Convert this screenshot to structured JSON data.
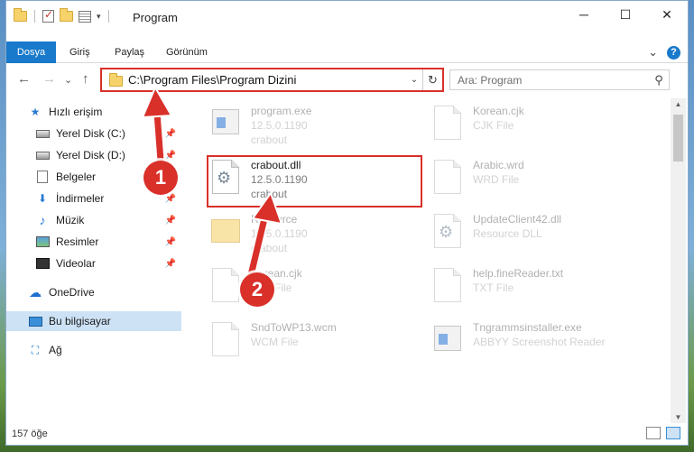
{
  "window": {
    "title": "Program",
    "controls": {
      "minimize": "─",
      "maximize": "☐",
      "close": "✕"
    }
  },
  "ribbon": {
    "tabs": [
      "Dosya",
      "Giriş",
      "Paylaş",
      "Görünüm"
    ],
    "expand_glyph": "⌄",
    "help_glyph": "?"
  },
  "nav": {
    "back": "←",
    "forward": "→",
    "recent": "⌄",
    "up": "↑",
    "address": "C:\\Program Files\\Program Dizini",
    "address_dropdown": "⌄",
    "refresh": "↻",
    "search_placeholder": "Ara: Program",
    "search_glyph": "⚲"
  },
  "sidebar": {
    "items": [
      {
        "label": "Hızlı erişim",
        "icon": "star-icon",
        "glyph": "★"
      },
      {
        "label": "Yerel Disk (C:)",
        "icon": "drive-icon",
        "pinned": true
      },
      {
        "label": "Yerel Disk (D:)",
        "icon": "drive-icon",
        "pinned": true
      },
      {
        "label": "Belgeler",
        "icon": "document-icon",
        "pinned": true
      },
      {
        "label": "İndirmeler",
        "icon": "download-icon",
        "glyph": "⬇",
        "pinned": true
      },
      {
        "label": "Müzik",
        "icon": "music-icon",
        "glyph": "♪",
        "pinned": true
      },
      {
        "label": "Resimler",
        "icon": "picture-icon",
        "pinned": true
      },
      {
        "label": "Videolar",
        "icon": "video-icon",
        "pinned": true
      },
      {
        "label": "OneDrive",
        "icon": "cloud-icon",
        "glyph": "☁"
      },
      {
        "label": "Bu bilgisayar",
        "icon": "computer-icon",
        "selected": true
      },
      {
        "label": "Ağ",
        "icon": "network-icon",
        "glyph": "⛶"
      }
    ],
    "pin_glyph": "📌"
  },
  "files": [
    {
      "name": "program.exe",
      "line2": "12.5.0.1190",
      "line3": "crabout",
      "icon": "exe-icon",
      "faded": true
    },
    {
      "name": "Korean.cjk",
      "line2": "CJK File",
      "line3": "",
      "icon": "file-icon",
      "faded": true
    },
    {
      "name": "crabout.dll",
      "line2": "12.5.0.1190",
      "line3": "crabout",
      "icon": "gear-file-icon",
      "faded": false,
      "highlighted": true
    },
    {
      "name": "Arabic.wrd",
      "line2": "WRD File",
      "line3": "",
      "icon": "file-icon",
      "faded": true
    },
    {
      "name": "Resource",
      "line2": "12.5.0.1190",
      "line3": "crabout",
      "icon": "folder-icon",
      "faded": true
    },
    {
      "name": "UpdateClient42.dll",
      "line2": "Resource DLL",
      "line3": "",
      "icon": "gear-file-icon",
      "faded": true
    },
    {
      "name": "Korean.cjk",
      "line2": "CJK File",
      "line3": "",
      "icon": "file-icon",
      "faded": true
    },
    {
      "name": "help.fineReader.txt",
      "line2": "TXT File",
      "line3": "",
      "icon": "file-icon",
      "faded": true
    },
    {
      "name": "SndToWP13.wcm",
      "line2": "WCM File",
      "line3": "",
      "icon": "file-icon",
      "faded": true
    },
    {
      "name": "Tngrammsinstaller.exe",
      "line2": "ABBYY Screenshot Reader",
      "line3": "",
      "icon": "exe-icon",
      "faded": true
    }
  ],
  "status": {
    "count": "157 öğe"
  },
  "annotations": {
    "step1": "1",
    "step2": "2",
    "color": "#d9302a"
  },
  "scroll": {
    "up": "▲",
    "down": "▼"
  }
}
